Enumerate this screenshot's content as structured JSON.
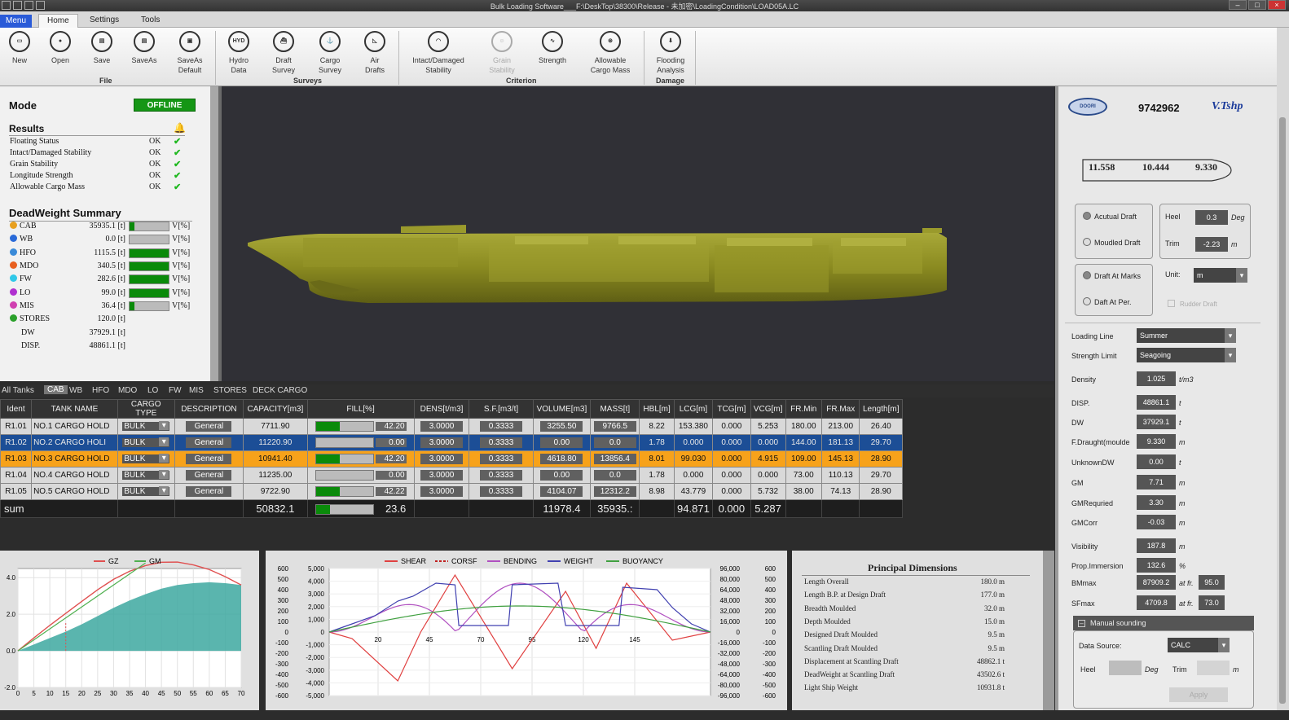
{
  "window": {
    "title": "Bulk Loading Software___F:\\DeskTop\\38300\\Release - 未加密\\LoadingCondition\\LOAD05A.LC"
  },
  "menu_tabs": {
    "menu": "Menu",
    "home": "Home",
    "settings": "Settings",
    "tools": "Tools"
  },
  "ribbon": {
    "new": "New",
    "open": "Open",
    "save": "Save",
    "saveas": "SaveAs",
    "saveas_default_1": "SaveAs",
    "saveas_default_2": "Default",
    "group_file": "File",
    "hydro_1": "Hydro",
    "hydro_2": "Data",
    "draft_1": "Draft",
    "draft_2": "Survey",
    "cargo_1": "Cargo",
    "cargo_2": "Survey",
    "air_1": "Air",
    "air_2": "Drafts",
    "group_surveys": "Surveys",
    "intact_1": "Intact/Damaged",
    "intact_2": "Stability",
    "grain_1": "Grain",
    "grain_2": "Stability",
    "strength": "Strength",
    "allow_1": "Allowable",
    "allow_2": "Cargo Mass",
    "group_criterion": "Criterion",
    "flood_1": "Flooding",
    "flood_2": "Analysis",
    "group_damage": "Damage",
    "hyd_icon": "HYD"
  },
  "mode": {
    "label": "Mode",
    "status": "OFFLINE"
  },
  "results": {
    "title": "Results",
    "items": [
      {
        "name": "Floating Status",
        "status": "OK"
      },
      {
        "name": "Intact/Damaged Stability",
        "status": "OK"
      },
      {
        "name": "Grain Stability",
        "status": "OK"
      },
      {
        "name": "Longitude Strength",
        "status": "OK"
      },
      {
        "name": "Allowable Cargo Mass",
        "status": "OK"
      }
    ]
  },
  "dw_summary": {
    "title": "DeadWeight Summary",
    "unit_col": "V[%]",
    "items": [
      {
        "name": "CAB",
        "value": "35935.1 [t]",
        "color": "#e8a020",
        "fill": 0.12
      },
      {
        "name": "WB",
        "value": "0.0 [t]",
        "color": "#2a6ad8",
        "fill": 0.0
      },
      {
        "name": "HFO",
        "value": "1115.5 [t]",
        "color": "#3a8ad8",
        "fill": 1.0
      },
      {
        "name": "MDO",
        "value": "340.5 [t]",
        "color": "#e86020",
        "fill": 1.0
      },
      {
        "name": "FW",
        "value": "282.6 [t]",
        "color": "#30c8e8",
        "fill": 1.0
      },
      {
        "name": "LO",
        "value": "99.0 [t]",
        "color": "#b030d0",
        "fill": 1.0
      },
      {
        "name": "MIS",
        "value": "36.4 [t]",
        "color": "#d040b0",
        "fill": 0.12
      },
      {
        "name": "STORES",
        "value": "120.0 [t]",
        "color": "#2aa02a"
      }
    ],
    "dw": {
      "name": "DW",
      "value": "37929.1 [t]"
    },
    "disp": {
      "name": "DISP.",
      "value": "48861.1 [t]"
    }
  },
  "tank_tabs": [
    "All Tanks",
    "CAB",
    "WB",
    "HFO",
    "MDO",
    "LO",
    "FW",
    "MIS",
    "STORES",
    "DECK CARGO"
  ],
  "table": {
    "headers": [
      "Ident",
      "TANK NAME",
      "CARGO TYPE",
      "DESCRIPTION",
      "CAPACITY[m3]",
      "FILL[%]",
      "DENS[t/m3]",
      "S.F.[m3/t]",
      "VOLUME[m3]",
      "MASS[t]",
      "HBL[m]",
      "LCG[m]",
      "TCG[m]",
      "VCG[m]",
      "FR.Min",
      "FR.Max",
      "Length[m]"
    ],
    "rows": [
      {
        "id": "R1.01",
        "name": "NO.1 CARGO HOLD",
        "type": "BULK",
        "desc": "General",
        "cap": "7711.90",
        "fill": 0.42,
        "fill_txt": "42.20",
        "dens": "3.0000",
        "sf": "0.3333",
        "vol": "3255.50",
        "mass": "9766.5",
        "hbl": "8.22",
        "lcg": "153.380",
        "tcg": "0.000",
        "vcg": "5.253",
        "frmin": "180.00",
        "frmax": "213.00",
        "len": "26.40"
      },
      {
        "id": "R1.02",
        "name": "NO.2 CARGO HOLI",
        "type": "BULK",
        "desc": "General",
        "cap": "11220.90",
        "fill": 0.0,
        "fill_txt": "0.00",
        "dens": "3.0000",
        "sf": "0.3333",
        "vol": "0.00",
        "mass": "0.0",
        "hbl": "1.78",
        "lcg": "0.000",
        "tcg": "0.000",
        "vcg": "0.000",
        "frmin": "144.00",
        "frmax": "181.13",
        "len": "29.70"
      },
      {
        "id": "R1.03",
        "name": "NO.3 CARGO HOLD",
        "type": "BULK",
        "desc": "General",
        "cap": "10941.40",
        "fill": 0.42,
        "fill_txt": "42.20",
        "dens": "3.0000",
        "sf": "0.3333",
        "vol": "4618.80",
        "mass": "13856.4",
        "hbl": "8.01",
        "lcg": "99.030",
        "tcg": "0.000",
        "vcg": "4.915",
        "frmin": "109.00",
        "frmax": "145.13",
        "len": "28.90"
      },
      {
        "id": "R1.04",
        "name": "NO.4 CARGO HOLD",
        "type": "BULK",
        "desc": "General",
        "cap": "11235.00",
        "fill": 0.0,
        "fill_txt": "0.00",
        "dens": "3.0000",
        "sf": "0.3333",
        "vol": "0.00",
        "mass": "0.0",
        "hbl": "1.78",
        "lcg": "0.000",
        "tcg": "0.000",
        "vcg": "0.000",
        "frmin": "73.00",
        "frmax": "110.13",
        "len": "29.70"
      },
      {
        "id": "R1.05",
        "name": "NO.5 CARGO HOLD",
        "type": "BULK",
        "desc": "General",
        "cap": "9722.90",
        "fill": 0.42,
        "fill_txt": "42.22",
        "dens": "3.0000",
        "sf": "0.3333",
        "vol": "4104.07",
        "mass": "12312.2",
        "hbl": "8.98",
        "lcg": "43.779",
        "tcg": "0.000",
        "vcg": "5.732",
        "frmin": "38.00",
        "frmax": "74.13",
        "len": "28.90"
      }
    ],
    "sum": {
      "label": "sum",
      "cap": "50832.1",
      "fill": 0.24,
      "fill_txt": "23.6",
      "vol": "11978.4",
      "mass": "35935.:",
      "lcg": "94.871",
      "tcg": "0.000",
      "vcg": "5.287"
    }
  },
  "right": {
    "ship_no": "9742962",
    "drafts": {
      "aft": "11.558",
      "mid": "10.444",
      "fwd": "9.330"
    },
    "acutual_draft": "Acutual Draft",
    "moulded_draft": "Moudled Draft",
    "heel_label": "Heel",
    "heel": "0.3",
    "heel_unit": "Deg",
    "trim_label": "Trim",
    "trim": "-2.23",
    "trim_unit": "m",
    "draft_marks": "Draft At Marks",
    "draft_per": "Daft At Per.",
    "unit_label": "Unit:",
    "unit": "m",
    "rudder": "Rudder Draft",
    "loading_line_label": "Loading Line",
    "loading_line": "Summer",
    "strength_limit_label": "Strength Limit",
    "strength_limit": "Seagoing",
    "params": [
      {
        "label": "Density",
        "value": "1.025",
        "unit": "t/m3"
      },
      {
        "label": "DISP.",
        "value": "48861.1",
        "unit": "t"
      },
      {
        "label": "DW",
        "value": "37929.1",
        "unit": "t"
      },
      {
        "label": "F.Draught(moulde",
        "value": "9.330",
        "unit": "m"
      },
      {
        "label": "UnknownDW",
        "value": "0.00",
        "unit": "t"
      },
      {
        "label": "GM",
        "value": "7.71",
        "unit": "m"
      },
      {
        "label": "GMRequried",
        "value": "3.30",
        "unit": "m"
      },
      {
        "label": "GMCorr",
        "value": "-0.03",
        "unit": "m"
      },
      {
        "label": "Visibility",
        "value": "187.8",
        "unit": "m"
      },
      {
        "label": "Prop.Immersion",
        "value": "132.6",
        "unit": "%"
      }
    ],
    "bmmax_label": "BMmax",
    "bmmax": "87909.2",
    "bm_at": "at fr.",
    "bm_fr": "95.0",
    "sfmax_label": "SFmax",
    "sfmax": "4709.8",
    "sf_at": "at fr.",
    "sf_fr": "73.0",
    "manual_title": "Manual sounding",
    "data_source_label": "Data Source:",
    "data_source": "CALC",
    "m_heel": "Heel",
    "m_heel_unit": "Deg",
    "m_trim": "Trim",
    "m_trim_unit": "m",
    "apply": "Apply"
  },
  "principal": {
    "title": "Principal Dimensions",
    "items": [
      {
        "name": "Length Overall",
        "value": "180.0 m"
      },
      {
        "name": "Length B.P. at Design Draft",
        "value": "177.0 m"
      },
      {
        "name": "Breadth Moulded",
        "value": "32.0 m"
      },
      {
        "name": "Depth Moulded",
        "value": "15.0 m"
      },
      {
        "name": "Designed Draft Moulded",
        "value": "9.5 m"
      },
      {
        "name": "Scantling Draft Moulded",
        "value": "9.5 m"
      },
      {
        "name": "Displacement at Scantling Draft",
        "value": "48862.1 t"
      },
      {
        "name": "DeadWeight at Scantling Draft",
        "value": "43502.6 t"
      },
      {
        "name": "Light Ship Weight",
        "value": "10931.8 t"
      }
    ]
  },
  "chart_data": [
    {
      "type": "area",
      "series": [
        {
          "name": "GZ",
          "color": "#e05050"
        },
        {
          "name": "GM",
          "color": "#50b050"
        }
      ],
      "x": [
        0,
        5,
        10,
        15,
        20,
        25,
        30,
        35,
        40,
        45,
        50,
        55,
        60,
        65,
        70
      ],
      "gz": [
        0,
        0.35,
        0.7,
        1.05,
        1.45,
        1.9,
        2.35,
        2.75,
        3.1,
        3.4,
        3.6,
        3.7,
        3.75,
        3.7,
        3.6
      ],
      "y_ticks": [
        "4.0",
        "2.0",
        "0.0",
        "-2.0"
      ],
      "x_ticks": [
        "0",
        "5",
        "10",
        "15",
        "20",
        "25",
        "30",
        "35",
        "40",
        "45",
        "50",
        "55",
        "60",
        "65",
        "70"
      ],
      "ylim": [
        -2,
        4.5
      ],
      "xlim": [
        0,
        70
      ]
    },
    {
      "type": "line",
      "series": [
        {
          "name": "SHEAR",
          "color": "#e04040"
        },
        {
          "name": "CORSF",
          "color": "#c02020"
        },
        {
          "name": "BENDING",
          "color": "#b050c0"
        },
        {
          "name": "WEIGHT",
          "color": "#4040b0"
        },
        {
          "name": "BUOYANCY",
          "color": "#40a040"
        }
      ],
      "x_ticks": [
        "20",
        "45",
        "70",
        "95",
        "120",
        "145"
      ],
      "y_left1": [
        "600",
        "500",
        "400",
        "300",
        "200",
        "100",
        "0",
        "-100",
        "-200",
        "-300",
        "-400",
        "-500",
        "-600"
      ],
      "y_left2": [
        "5,000",
        "4,000",
        "3,000",
        "2,000",
        "1,000",
        "0",
        "-1,000",
        "-2,000",
        "-3,000",
        "-4,000",
        "-5,000"
      ],
      "y_right1": [
        "96,000",
        "80,000",
        "64,000",
        "48,000",
        "32,000",
        "16,000",
        "0",
        "-16,000",
        "-32,000",
        "-48,000",
        "-64,000",
        "-80,000",
        "-96,000"
      ],
      "y_right2": [
        "600",
        "500",
        "400",
        "300",
        "200",
        "100",
        "0",
        "-100",
        "-200",
        "-300",
        "-400",
        "-500",
        "-600"
      ]
    }
  ]
}
